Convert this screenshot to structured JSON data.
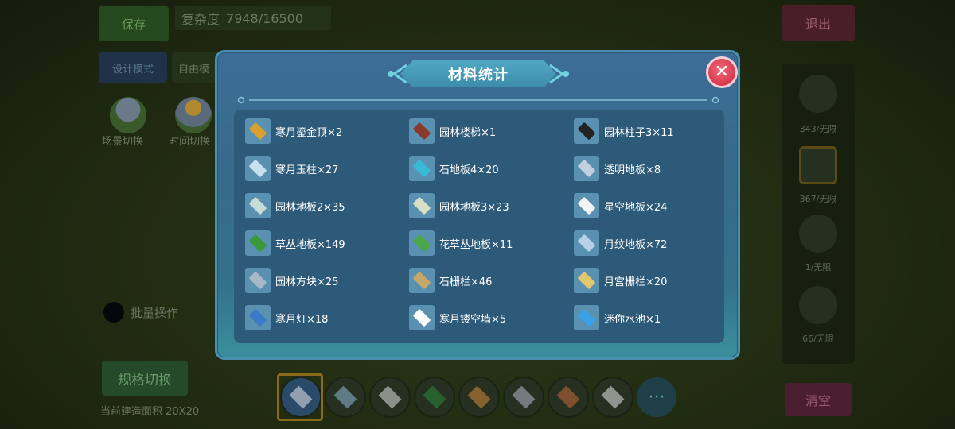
{
  "background": {
    "save_label": "保存",
    "complexity_label": "复杂度",
    "complexity_value": "7948/16500",
    "exit_label": "退出",
    "design_mode_label": "设计模式",
    "free_mode_label": "自由模",
    "scene_switch_label": "场景切换",
    "time_switch_label": "时间切换",
    "batch_label": "批量操作",
    "spec_switch_label": "规格切换",
    "build_area_label": "当前建造面积 20X20",
    "clear_label": "清空",
    "right_panel": [
      {
        "label": "343/无限",
        "icon": "railing-icon"
      },
      {
        "label": "367/无限",
        "icon": "wall-block-icon"
      },
      {
        "label": "1/无限",
        "icon": "pillar-block-icon"
      },
      {
        "label": "66/无限",
        "icon": "stair-block-icon"
      }
    ],
    "hotbar": [
      {
        "icon": "eraser-icon",
        "color": "#e6e6e6"
      },
      {
        "icon": "moon-tile-icon",
        "color": "#8fb8d8"
      },
      {
        "icon": "white-tile-icon",
        "color": "#e0e0e0"
      },
      {
        "icon": "grass-block-icon",
        "color": "#2e8a3a"
      },
      {
        "icon": "pattern-tile-icon",
        "color": "#d48a3a"
      },
      {
        "icon": "stone-block-icon",
        "color": "#b8b8c8"
      },
      {
        "icon": "brick-tile-icon",
        "color": "#c86a3a"
      },
      {
        "icon": "white-block-icon",
        "color": "#e8e8e8"
      }
    ],
    "more_label": "···"
  },
  "modal": {
    "title": "材料统计",
    "close_label": "✕",
    "items": [
      {
        "name": "寒月鎏金顶×2",
        "icon": "golden-roof-icon",
        "color": "#d8a030"
      },
      {
        "name": "园林楼梯×1",
        "icon": "garden-stairs-icon",
        "color": "#8a3a2a"
      },
      {
        "name": "园林柱子3×11",
        "icon": "garden-pillar-icon",
        "color": "#222222"
      },
      {
        "name": "寒月玉柱×27",
        "icon": "jade-pillar-icon",
        "color": "#c8e0f0"
      },
      {
        "name": "石地板4×20",
        "icon": "stone-floor-icon",
        "color": "#3ab8d8"
      },
      {
        "name": "透明地板×8",
        "icon": "glass-floor-icon",
        "color": "#c0d0dc"
      },
      {
        "name": "园林地板2×35",
        "icon": "garden-floor2-icon",
        "color": "#c8dcd8"
      },
      {
        "name": "园林地板3×23",
        "icon": "garden-floor3-icon",
        "color": "#d8e0c8"
      },
      {
        "name": "星空地板×24",
        "icon": "starry-floor-icon",
        "color": "#f4f4f4"
      },
      {
        "name": "草丛地板×149",
        "icon": "grass-floor-icon",
        "color": "#3a9a3a"
      },
      {
        "name": "花草丛地板×11",
        "icon": "flower-grass-floor-icon",
        "color": "#4aa84a"
      },
      {
        "name": "月纹地板×72",
        "icon": "moon-pattern-floor-icon",
        "color": "#b8d0e8"
      },
      {
        "name": "园林方块×25",
        "icon": "garden-block-icon",
        "color": "#a8b8c8"
      },
      {
        "name": "石栅栏×46",
        "icon": "stone-fence-icon",
        "color": "#c8a868"
      },
      {
        "name": "月宫栅栏×20",
        "icon": "moon-palace-fence-icon",
        "color": "#e0c870"
      },
      {
        "name": "寒月灯×18",
        "icon": "moon-lamp-icon",
        "color": "#3a7ac8"
      },
      {
        "name": "寒月镂空墙×5",
        "icon": "hollow-wall-icon",
        "color": "#ffffff"
      },
      {
        "name": "迷你水池×1",
        "icon": "mini-pool-icon",
        "color": "#3aa0e8"
      }
    ]
  }
}
